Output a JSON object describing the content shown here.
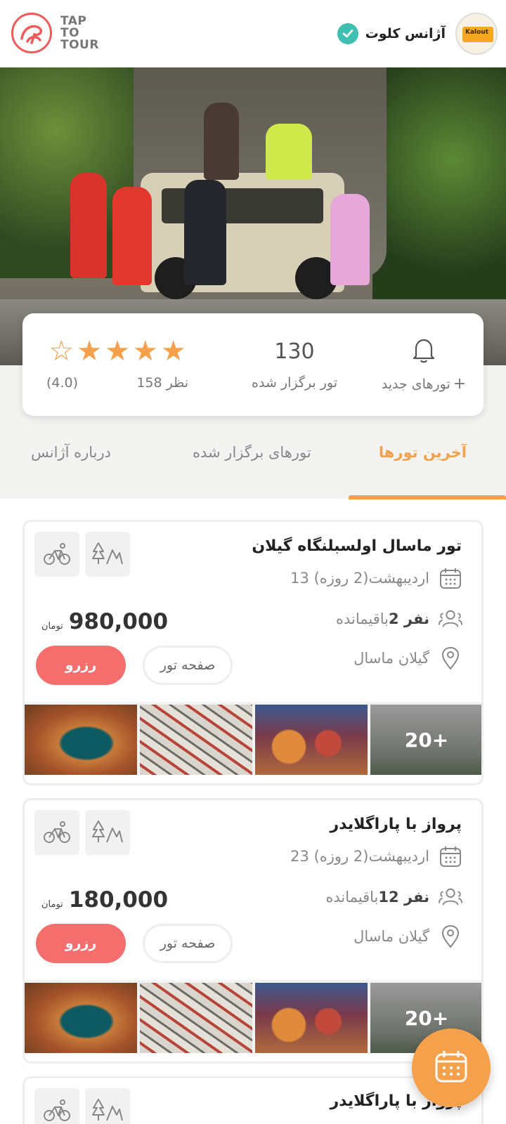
{
  "header": {
    "logo_text_lines": [
      "TAP",
      "TO",
      "TOUR"
    ],
    "agency_name": "آژانس کلوت",
    "agency_logo_text": "Kalout"
  },
  "stats": {
    "new_tours_label": "تورهای جدید",
    "tours_held_count": "130",
    "tours_held_label": "تور برگزار شده",
    "reviews_label": "158 نظر",
    "rating_text": "(4.0)",
    "rating_value": 4.0,
    "stars_total": 5
  },
  "tabs": [
    {
      "label": "آخرین تورها",
      "active": true
    },
    {
      "label": "تورهای برگزار شده",
      "active": false
    },
    {
      "label": "درباره آژانس",
      "active": false
    }
  ],
  "tours": [
    {
      "title": "تور ماسال اولسبلنگاه گیلان",
      "date": "13 اردیبهشت(2 روزه)",
      "capacity_number": "2 نفر",
      "capacity_suffix": "باقیمانده",
      "location": "گیلان ماسال",
      "price": "980,000",
      "currency": "تومان",
      "reserve_label": "رزرو",
      "page_label": "صفحه تور",
      "more_images": "20+"
    },
    {
      "title": "پرواز با پاراگلایدر",
      "date": "23 اردیبهشت(2 روزه)",
      "capacity_number": "12 نفر",
      "capacity_suffix": "باقیمانده",
      "location": "گیلان ماسال",
      "price": "180,000",
      "currency": "تومان",
      "reserve_label": "رزرو",
      "page_label": "صفحه تور",
      "more_images": "20+"
    },
    {
      "title": "پرواز با پاراگلایدر"
    }
  ],
  "colors": {
    "accent": "#f5a04a",
    "reserve": "#f46e6e",
    "verified": "#3fbfb0"
  }
}
